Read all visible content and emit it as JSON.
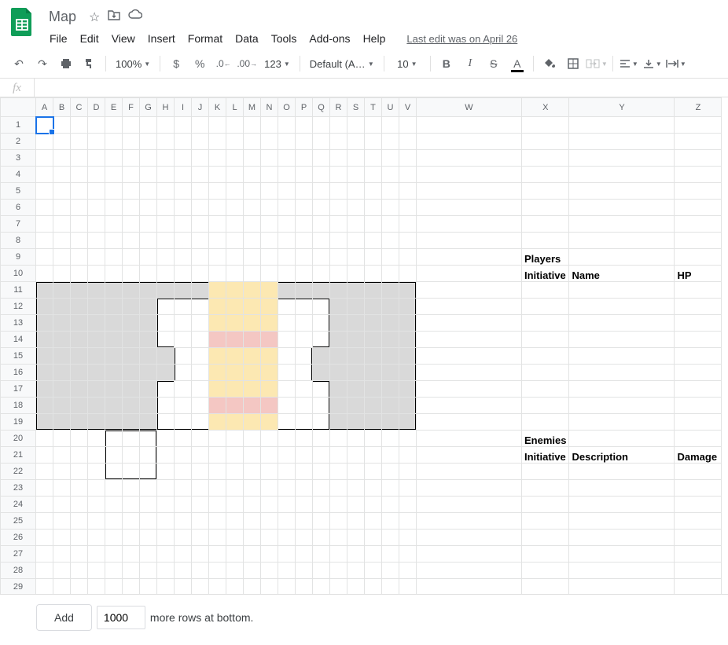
{
  "doc": {
    "title": "Map"
  },
  "menu": {
    "file": "File",
    "edit": "Edit",
    "view": "View",
    "insert": "Insert",
    "format": "Format",
    "data": "Data",
    "tools": "Tools",
    "addons": "Add-ons",
    "help": "Help",
    "lastEdit": "Last edit was on April 26"
  },
  "toolbar": {
    "zoom": "100%",
    "font": "Default (Ari...",
    "size": "10",
    "num123": "123"
  },
  "formula": {
    "fx": "fx",
    "value": ""
  },
  "columns": [
    "A",
    "B",
    "C",
    "D",
    "E",
    "F",
    "G",
    "H",
    "I",
    "J",
    "K",
    "L",
    "M",
    "N",
    "O",
    "P",
    "Q",
    "R",
    "S",
    "T",
    "U",
    "V",
    "W",
    "X",
    "Y",
    "Z"
  ],
  "rows": 30,
  "cells": {
    "X9": "Players",
    "X10": "Initiative",
    "Y10": "Name",
    "Z10": "HP",
    "X20": "Enemies",
    "X21": "Initiative",
    "Y21": "Description",
    "Z21": "Damage"
  },
  "boldCells": [
    "X9",
    "X10",
    "Y10",
    "Z10",
    "X20",
    "X21",
    "Y21",
    "Z21"
  ],
  "footer": {
    "add": "Add",
    "rows": "1000",
    "suffix": "more rows at bottom."
  },
  "selectedCell": "A1"
}
